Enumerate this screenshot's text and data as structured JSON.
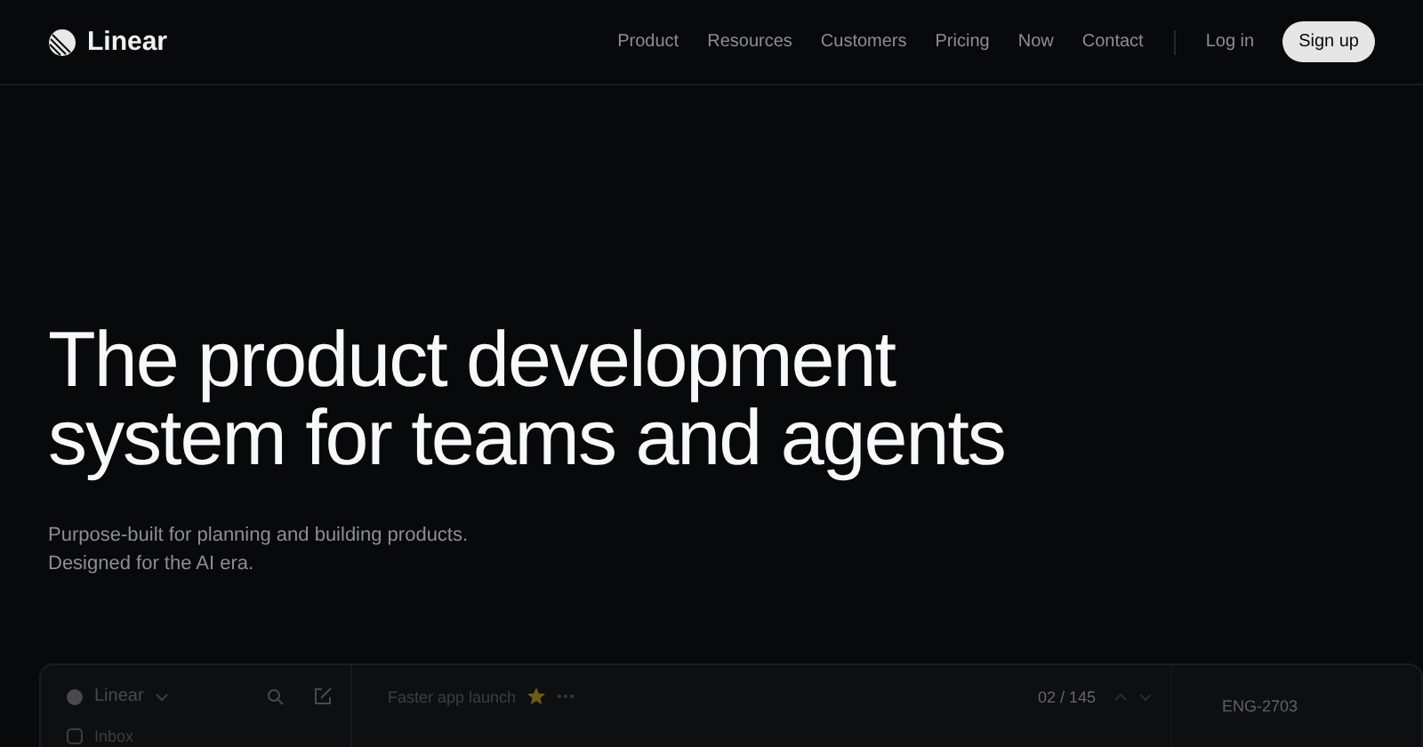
{
  "header": {
    "brand": "Linear",
    "nav": [
      "Product",
      "Resources",
      "Customers",
      "Pricing",
      "Now",
      "Contact"
    ],
    "login": "Log in",
    "signup": "Sign up"
  },
  "hero": {
    "title": "The product development system for teams and agents",
    "subtitle_lines": [
      "Purpose-built for planning and building products.",
      "Designed for the AI era."
    ]
  },
  "app_preview": {
    "workspace": "Linear",
    "sidebar_items": [
      "Inbox"
    ],
    "issue_title": "Faster app launch",
    "starred": true,
    "counter": "02 / 145",
    "issue_id": "ENG-2703"
  }
}
